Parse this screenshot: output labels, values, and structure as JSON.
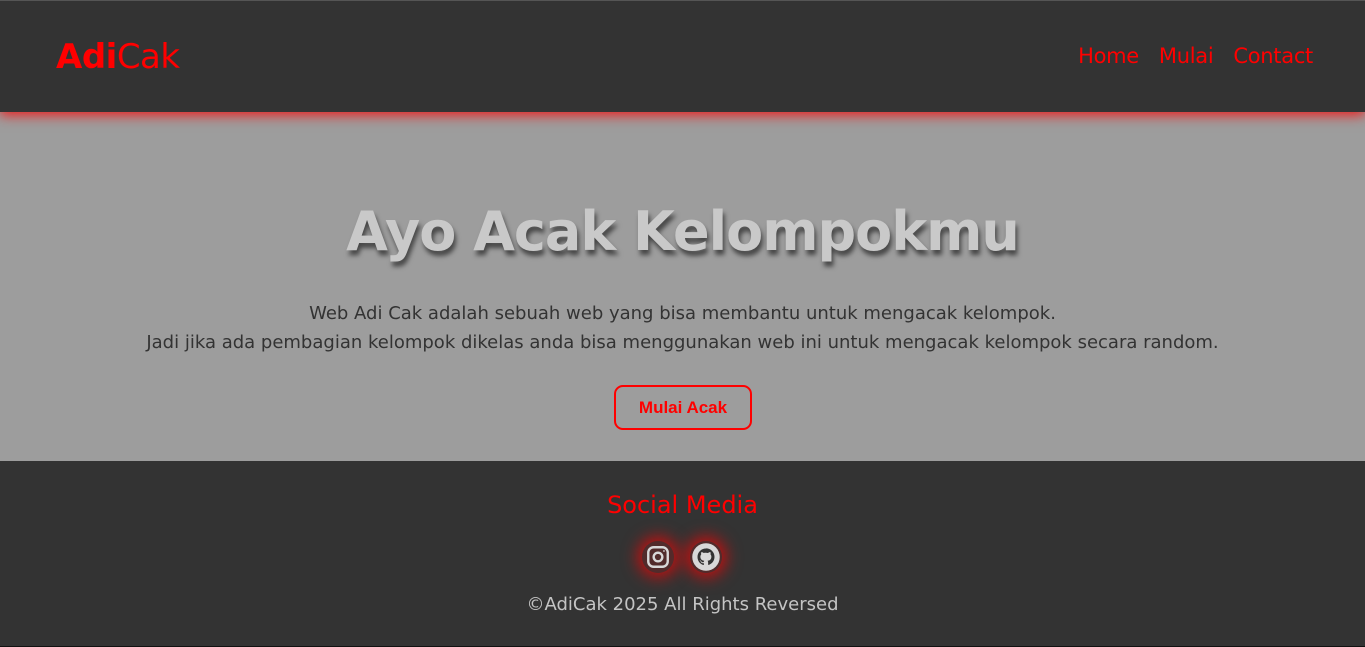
{
  "nav": {
    "brand_part1": "Adi",
    "brand_part2": "Cak",
    "links": [
      "Home",
      "Mulai",
      "Contact"
    ]
  },
  "hero": {
    "title": "Ayo Acak Kelompokmu",
    "description_line1": "Web Adi Cak adalah sebuah web yang bisa membantu untuk mengacak kelompok.",
    "description_line2": "Jadi jika ada pembagian kelompok dikelas anda bisa menggunakan web ini untuk mengacak kelompok secara random.",
    "cta_label": "Mulai Acak"
  },
  "footer": {
    "heading": "Social Media",
    "icons": [
      "instagram-icon",
      "github-icon"
    ],
    "copyright": "©AdiCak 2025 All Rights Reversed"
  },
  "colors": {
    "accent": "#ff0000",
    "dark": "#333333",
    "hero_bg": "#9d9d9d"
  }
}
